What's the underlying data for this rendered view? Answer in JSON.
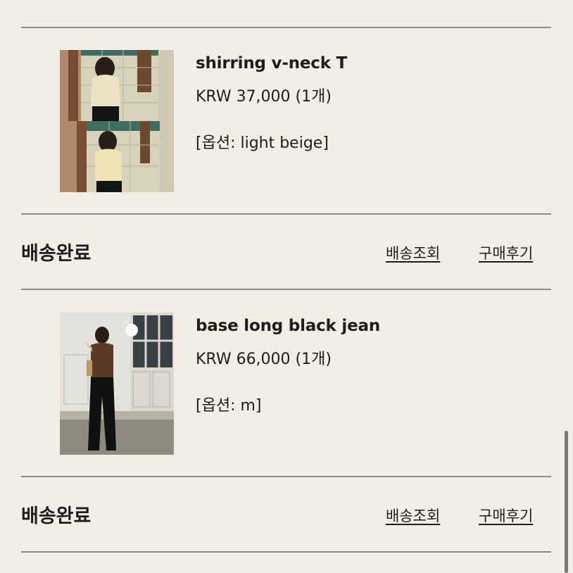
{
  "orders": [
    {
      "product": {
        "name": "shirring v-neck T",
        "price": "KRW 37,000 (1개)",
        "option": "[옵션: light beige]"
      },
      "status": "배송완료",
      "actions": {
        "track": "배송조회",
        "review": "구매후기"
      }
    },
    {
      "product": {
        "name": "base long black jean",
        "price": "KRW 66,000 (1개)",
        "option": "[옵션: m]"
      },
      "status": "배송완료",
      "actions": {
        "track": "배송조회",
        "review": "구매후기"
      }
    }
  ]
}
